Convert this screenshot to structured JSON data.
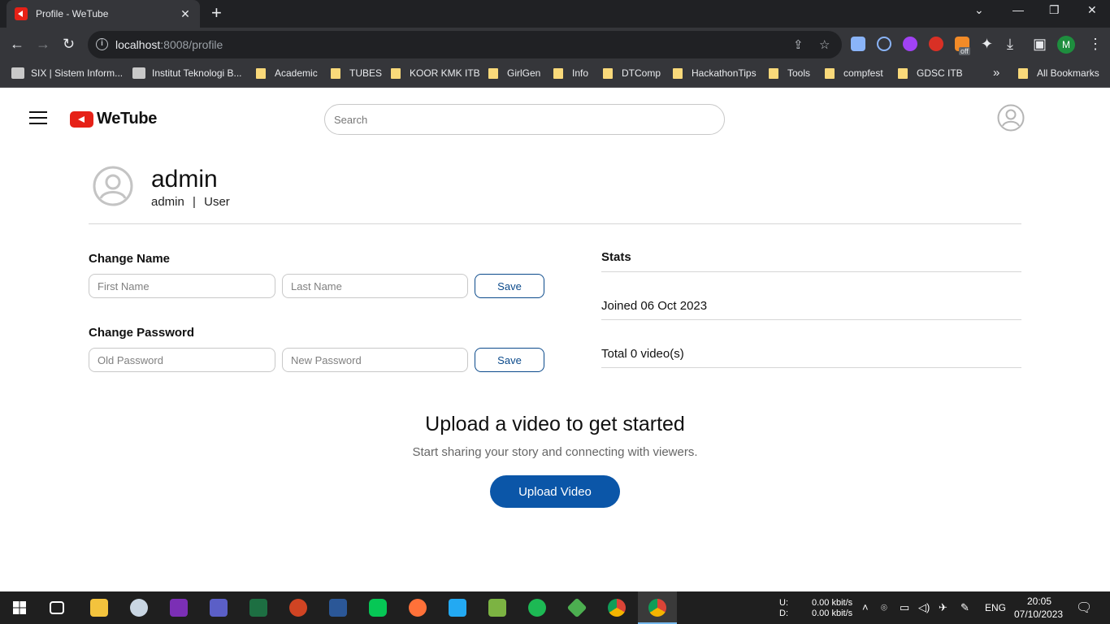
{
  "browser": {
    "tab_title": "Profile - WeTube",
    "tab_close": "✕",
    "new_tab": "+",
    "url_host": "localhost",
    "url_rest": ":8008/profile",
    "profile_initial": "M",
    "bookmarks": [
      "SIX | Sistem Inform...",
      "Institut Teknologi B...",
      "Academic",
      "TUBES",
      "KOOR KMK ITB",
      "GirlGen",
      "Info",
      "DTComp",
      "HackathonTips",
      "Tools",
      "compfest",
      "GDSC ITB"
    ],
    "bookmarks_more": "»",
    "all_bookmarks": "All Bookmarks",
    "extension_badge": "off"
  },
  "header": {
    "logo_text": "WeTube",
    "search_placeholder": "Search"
  },
  "profile": {
    "display_name": "admin",
    "username": "admin",
    "separator": "|",
    "role": "User"
  },
  "change_name": {
    "title": "Change Name",
    "first_placeholder": "First Name",
    "last_placeholder": "Last Name",
    "save_label": "Save"
  },
  "change_password": {
    "title": "Change Password",
    "old_placeholder": "Old Password",
    "new_placeholder": "New Password",
    "save_label": "Save"
  },
  "stats": {
    "title": "Stats",
    "joined": "Joined 06 Oct 2023",
    "total": "Total 0 video(s)"
  },
  "cta": {
    "title": "Upload a video to get started",
    "subtitle": "Start sharing your story and connecting with viewers.",
    "button_label": "Upload Video"
  },
  "taskbar": {
    "net_up_label": "U:",
    "net_down_label": "D:",
    "net_up": "0.00 kbit/s",
    "net_down": "0.00 kbit/s",
    "language": "ENG",
    "time": "20:05",
    "date": "07/10/2023"
  }
}
